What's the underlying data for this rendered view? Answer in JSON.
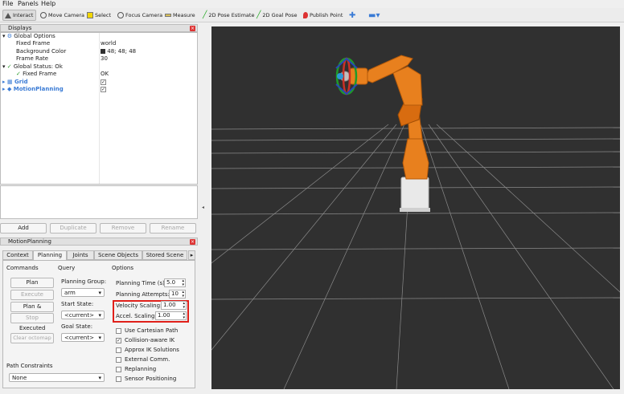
{
  "menu": [
    "File",
    "Panels",
    "Help"
  ],
  "toolbar": {
    "interact": "Interact",
    "move_camera": "Move Camera",
    "select": "Select",
    "focus_camera": "Focus Camera",
    "measure": "Measure",
    "pose_estimate": "2D Pose Estimate",
    "goal_pose": "2D Goal Pose",
    "publish_point": "Publish Point"
  },
  "displays": {
    "title": "Displays",
    "global_options": "Global Options",
    "fixed_frame_label": "Fixed Frame",
    "fixed_frame_value": "world",
    "bg_color_label": "Background Color",
    "bg_color_value": "48; 48; 48",
    "frame_rate_label": "Frame Rate",
    "frame_rate_value": "30",
    "global_status": "Global Status: Ok",
    "status_fixed_frame_label": "Fixed Frame",
    "status_fixed_frame_value": "OK",
    "grid": "Grid",
    "motion_planning": "MotionPlanning",
    "buttons": {
      "add": "Add",
      "duplicate": "Duplicate",
      "remove": "Remove",
      "rename": "Rename"
    }
  },
  "motion_panel": {
    "title": "MotionPlanning",
    "tabs": [
      "Context",
      "Planning",
      "Joints",
      "Scene Objects",
      "Stored Scene"
    ],
    "commands": "Commands",
    "query": "Query",
    "options": "Options",
    "plan": "Plan",
    "execute": "Execute",
    "plan_execute": "Plan & Execute",
    "stop": "Stop",
    "executed": "Executed",
    "clear_octomap": "Clear octomap",
    "planning_group_label": "Planning Group:",
    "planning_group_value": "arm",
    "start_state_label": "Start State:",
    "start_state_value": "<current>",
    "goal_state_label": "Goal State:",
    "goal_state_value": "<current>",
    "planning_time_label": "Planning Time (s):",
    "planning_time_value": "5.0",
    "planning_attempts_label": "Planning Attempts:",
    "planning_attempts_value": "10",
    "velocity_label": "Velocity Scaling:",
    "velocity_value": "1.00",
    "accel_label": "Accel. Scaling:",
    "accel_value": "1.00",
    "checks": [
      {
        "label": "Use Cartesian Path",
        "checked": false
      },
      {
        "label": "Collision-aware IK",
        "checked": true
      },
      {
        "label": "Approx IK Solutions",
        "checked": false
      },
      {
        "label": "External Comm.",
        "checked": false
      },
      {
        "label": "Replanning",
        "checked": false
      },
      {
        "label": "Sensor Positioning",
        "checked": false
      }
    ],
    "path_constraints_label": "Path Constraints",
    "path_constraints_value": "None"
  },
  "colors": {
    "viewport_bg": "#303030",
    "robot": "#e8801e",
    "highlight": "#e0201a"
  }
}
